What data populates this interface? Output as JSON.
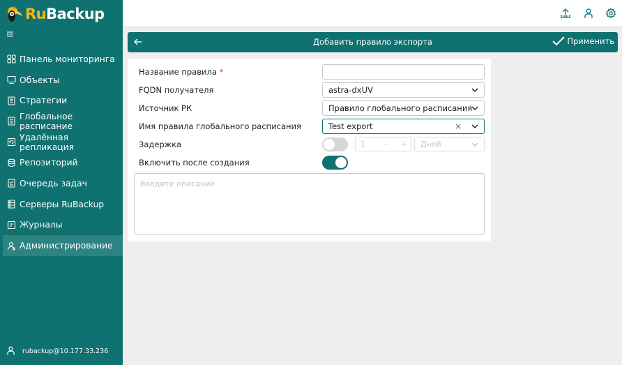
{
  "app": {
    "logo_ru": "Ru",
    "logo_backup": "Backup"
  },
  "sidebar": {
    "items": [
      {
        "label": "Панель мониторинга",
        "icon": "dashboard-icon"
      },
      {
        "label": "Объекты",
        "icon": "monitor-icon"
      },
      {
        "label": "Стратегии",
        "icon": "document-icon"
      },
      {
        "label": "Глобальное расписание",
        "icon": "document-icon"
      },
      {
        "label": "Удалённая репликация",
        "icon": "replication-icon"
      },
      {
        "label": "Репозиторий",
        "icon": "database-icon"
      },
      {
        "label": "Очередь задач",
        "icon": "task-queue-icon"
      },
      {
        "label": "Серверы RuBackup",
        "icon": "server-icon"
      },
      {
        "label": "Журналы",
        "icon": "log-icon"
      },
      {
        "label": "Администрирование",
        "icon": "admin-user-icon",
        "active": true
      }
    ],
    "user": "rubackup@10.177.33.236"
  },
  "header": {
    "title": "Добавить правило экспорта",
    "apply_label": "Применить"
  },
  "form": {
    "rule_name": {
      "label": "Название правила",
      "required_mark": "*",
      "value": ""
    },
    "fqdn": {
      "label": "FQDN получателя",
      "value": "astra-dxUV"
    },
    "source": {
      "label": "Источник РК",
      "value": "Правило глобального расписания"
    },
    "schedule_rule": {
      "label": "Имя правила глобального расписания",
      "value": "Test export",
      "clear": "×"
    },
    "delay": {
      "label": "Задержка",
      "enabled": false,
      "value": "1",
      "minus": "-",
      "plus": "+",
      "unit": "Дней"
    },
    "enable_after": {
      "label": "Включить после создания",
      "enabled": true
    },
    "description": {
      "placeholder": "Введите описание"
    }
  },
  "colors": {
    "brand": "#0f7170",
    "accent": "#f2b41c",
    "required": "#d9312b"
  }
}
